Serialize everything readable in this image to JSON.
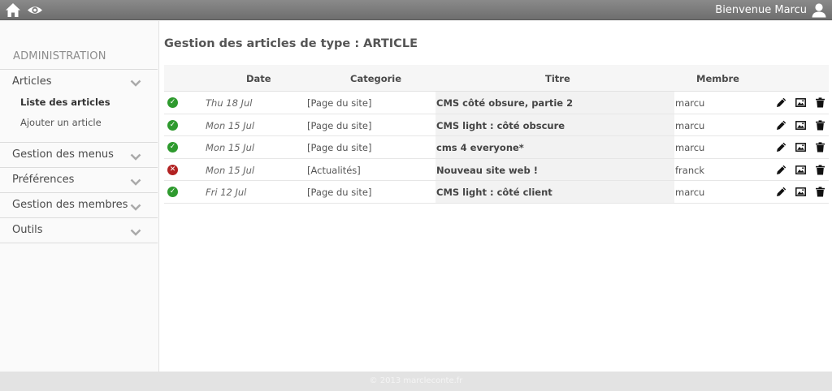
{
  "header": {
    "welcome": "Bienvenue Marcu",
    "icons": [
      "home-icon",
      "eye-icon",
      "user-icon"
    ]
  },
  "sidebar": {
    "title": "ADMINISTRATION",
    "sections": [
      {
        "label": "Articles",
        "subitems": [
          {
            "label": "Liste des articles",
            "active": true
          },
          {
            "label": "Ajouter un article",
            "active": false
          }
        ]
      },
      {
        "label": "Gestion des menus"
      },
      {
        "label": "Préférences"
      },
      {
        "label": "Gestion des membres"
      },
      {
        "label": "Outils"
      }
    ]
  },
  "main": {
    "title": "Gestion des articles de type : ARTICLE",
    "columns": {
      "date": "Date",
      "categorie": "Categorie",
      "titre": "Titre",
      "membre": "Membre"
    },
    "rows": [
      {
        "status": "published",
        "date": "Thu 18 Jul",
        "categorie": "[Page du site]",
        "titre": "CMS côté obsure, partie 2",
        "membre": "marcu"
      },
      {
        "status": "published",
        "date": "Mon 15 Jul",
        "categorie": "[Page du site]",
        "titre": "CMS light : côté obscure",
        "membre": "marcu"
      },
      {
        "status": "published",
        "date": "Mon 15 Jul",
        "categorie": "[Page du site]",
        "titre": "cms 4 everyone*",
        "membre": "marcu"
      },
      {
        "status": "unpublished",
        "date": "Mon 15 Jul",
        "categorie": "[Actualités]",
        "titre": "Nouveau site web !",
        "membre": "franck"
      },
      {
        "status": "published",
        "date": "Fri 12 Jul",
        "categorie": "[Page du site]",
        "titre": "CMS light : côté client",
        "membre": "marcu"
      }
    ],
    "row_actions": [
      "pencil-icon",
      "image-icon",
      "trash-icon"
    ]
  },
  "footer": {
    "text": "© 2013 marcleconte.fr"
  },
  "colors": {
    "published": "#2e9a2e",
    "unpublished": "#b22222",
    "topbar": "#7b7b7b"
  }
}
